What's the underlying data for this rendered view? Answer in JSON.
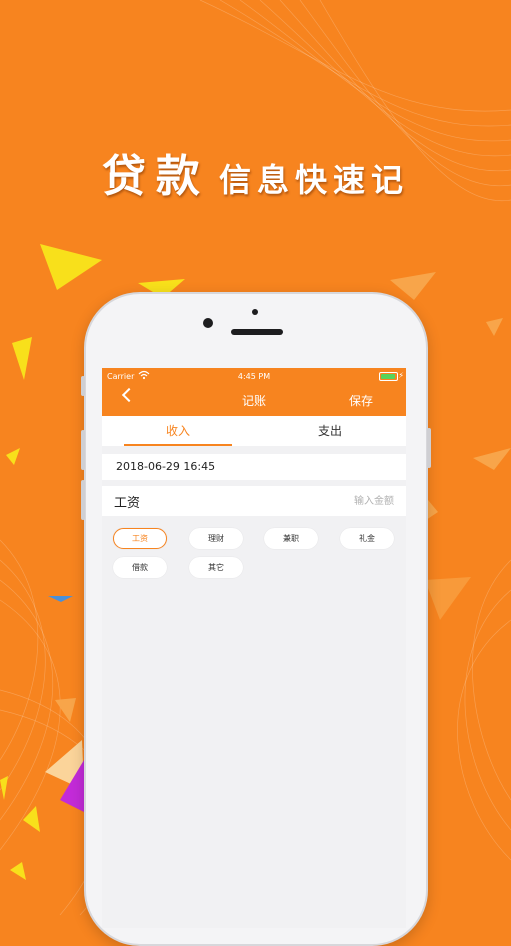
{
  "headline": {
    "big": "贷款",
    "small": "信息快速记"
  },
  "status_bar": {
    "carrier": "Carrier",
    "time": "4:45 PM"
  },
  "nav": {
    "title": "记账",
    "save_label": "保存"
  },
  "tabs": [
    {
      "label": "收入",
      "active": true
    },
    {
      "label": "支出",
      "active": false
    }
  ],
  "entry": {
    "date": "2018-06-29 16:45",
    "category": "工资",
    "amount_placeholder": "输入金额"
  },
  "categories": [
    {
      "label": "工资",
      "selected": true
    },
    {
      "label": "理财",
      "selected": false
    },
    {
      "label": "兼职",
      "selected": false
    },
    {
      "label": "礼金",
      "selected": false
    },
    {
      "label": "借款",
      "selected": false
    },
    {
      "label": "其它",
      "selected": false
    }
  ],
  "colors": {
    "accent": "#F7841F",
    "background": "#F7841F",
    "screen": "#f1f1f3"
  }
}
